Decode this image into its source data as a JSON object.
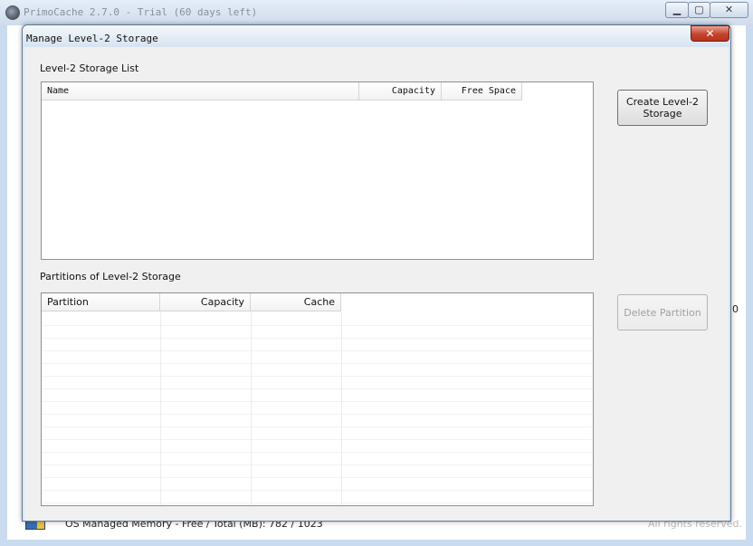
{
  "main_window": {
    "title": "PrimoCache 2.7.0 - Trial (60 days left)",
    "controls": {
      "minimize": "▁",
      "maximize": "▢",
      "close": "✕"
    },
    "memory_label": "OS Managed Memory - Free / Total (MB):   782 / 1023",
    "rights": "All rights reserved.",
    "side_value": "0"
  },
  "dialog": {
    "title": "Manage Level-2 Storage",
    "close": "✕",
    "storage_list": {
      "label": "Level-2 Storage List",
      "columns": [
        "Name",
        "Capacity",
        "Free Space"
      ],
      "rows": []
    },
    "partitions": {
      "label": "Partitions of Level-2 Storage",
      "columns": [
        "Partition",
        "Capacity",
        "Cache"
      ],
      "rows": []
    },
    "buttons": {
      "create": "Create Level-2 Storage",
      "delete": "Delete Partition"
    }
  },
  "icons": {
    "app": "app-disk-icon",
    "memory": "memory-chip-icon"
  }
}
